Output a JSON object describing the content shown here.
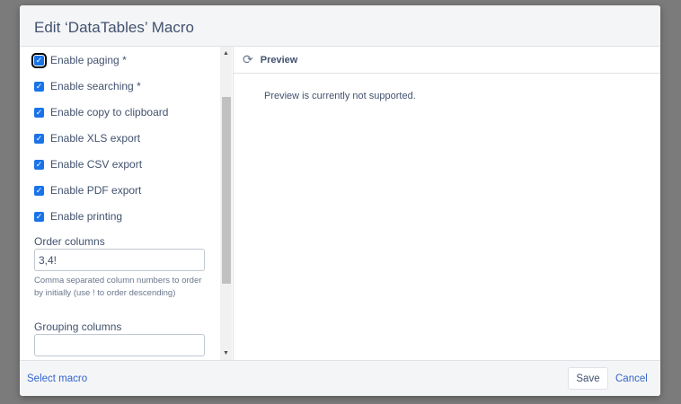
{
  "dialog": {
    "title": "Edit ‘DataTables’ Macro"
  },
  "options": [
    {
      "label": "Enable paging *",
      "checked": true
    },
    {
      "label": "Enable searching *",
      "checked": true
    },
    {
      "label": "Enable copy to clipboard",
      "checked": true
    },
    {
      "label": "Enable XLS export",
      "checked": true
    },
    {
      "label": "Enable CSV export",
      "checked": true
    },
    {
      "label": "Enable PDF export",
      "checked": true
    },
    {
      "label": "Enable printing",
      "checked": true
    }
  ],
  "order_columns": {
    "label": "Order columns",
    "value": "3,4!",
    "help": "Comma separated column numbers to order by initially (use ! to order descending)"
  },
  "grouping_columns": {
    "label": "Grouping columns",
    "value": ""
  },
  "preview": {
    "title": "Preview",
    "message": "Preview is currently not supported."
  },
  "footer": {
    "select_macro": "Select macro",
    "save": "Save",
    "cancel": "Cancel"
  },
  "colors": {
    "accent": "#1a73e8",
    "link": "#3366cc"
  }
}
